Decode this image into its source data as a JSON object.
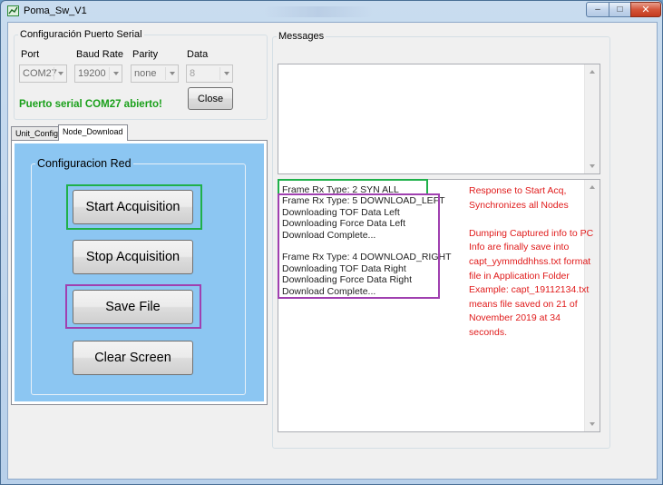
{
  "window": {
    "title": "Poma_Sw_V1",
    "minimize": "–",
    "maximize": "□",
    "close": "✕",
    "icon": "app-icon"
  },
  "serial": {
    "legend": "Configuración Puerto Serial",
    "labels": {
      "port": "Port",
      "baud": "Baud Rate",
      "parity": "Parity",
      "data": "Data"
    },
    "values": {
      "port": "COM27",
      "baud": "19200",
      "parity": "none",
      "data": "8"
    },
    "status": "Puerto serial COM27 abierto!",
    "close_button": "Close",
    "status_color": "#1aa01a"
  },
  "tabs": [
    {
      "label": "Unit_Config",
      "active": false
    },
    {
      "label": "Node_Download",
      "active": true
    }
  ],
  "red": {
    "legend": "Configuracion Red",
    "buttons": {
      "start": "Start Acquisition",
      "stop": "Stop Acquisition",
      "save": "Save File",
      "clear": "Clear Screen"
    },
    "panel_color": "#8cc6f2"
  },
  "messages": {
    "legend": "Messages",
    "top_text": "",
    "log": [
      "Frame Rx Type: 2 SYN ALL",
      "Frame Rx Type: 5 DOWNLOAD_LEFT",
      "Downloading TOF Data Left",
      "Downloading Force Data Left",
      "Download Complete...",
      "",
      "Frame Rx Type: 4 DOWNLOAD_RIGHT",
      "Downloading TOF Data Right",
      "Downloading Force Data Right",
      "Download Complete..."
    ]
  },
  "annotations": {
    "color": "#e01b1b",
    "green_color": "#1fb04a",
    "purple_color": "#a040b0",
    "lines": [
      "Response to Start Acq,",
      "Synchronizes all Nodes",
      "",
      "Dumping Captured info to PC",
      "Info are finally save into",
      "capt_yymmddhhss.txt  format",
      "file in Application Folder",
      "Example: capt_19112134.txt",
      "means file saved on 21 of",
      "November 2019 at 34",
      "seconds."
    ]
  }
}
